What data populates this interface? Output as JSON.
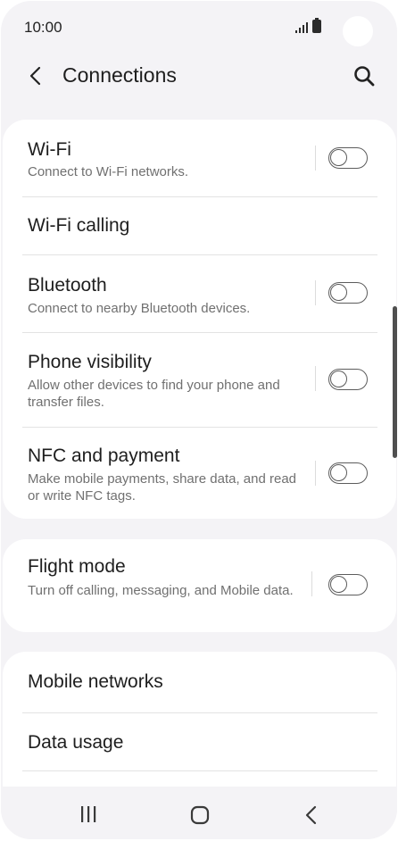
{
  "status_bar": {
    "time": "10:00"
  },
  "header": {
    "title": "Connections"
  },
  "groups": [
    {
      "items": [
        {
          "label": "Wi-Fi",
          "sub": "Connect to Wi-Fi networks.",
          "toggle": false
        },
        {
          "label": "Wi-Fi calling"
        },
        {
          "label": "Bluetooth",
          "sub": "Connect to nearby Bluetooth devices.",
          "toggle": false
        },
        {
          "label": "Phone visibility",
          "sub": "Allow other devices to find your phone and transfer files.",
          "toggle": false
        },
        {
          "label": "NFC and payment",
          "sub": "Make mobile payments, share data, and read or write NFC tags.",
          "toggle": false
        }
      ]
    },
    {
      "items": [
        {
          "label": "Flight mode",
          "sub": "Turn off calling, messaging, and Mobile data.",
          "toggle": false
        }
      ]
    },
    {
      "items": [
        {
          "label": "Mobile networks"
        },
        {
          "label": "Data usage"
        }
      ]
    }
  ]
}
